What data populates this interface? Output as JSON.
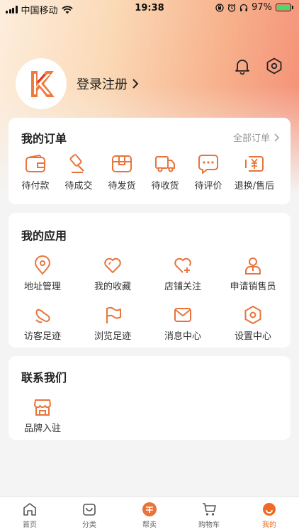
{
  "status_bar": {
    "carrier": "中国移动",
    "time": "19:38",
    "battery": "97%"
  },
  "profile": {
    "avatar_logo": "K",
    "login_label": "登录注册"
  },
  "orders": {
    "title": "我的订单",
    "all_link": "全部订单",
    "items": [
      {
        "label": "待付款",
        "icon": "wallet-icon"
      },
      {
        "label": "待成交",
        "icon": "hammer-icon"
      },
      {
        "label": "待发货",
        "icon": "box-icon"
      },
      {
        "label": "待收货",
        "icon": "truck-icon"
      },
      {
        "label": "待评价",
        "icon": "chat-bubble-icon"
      },
      {
        "label": "退换/售后",
        "icon": "refund-icon"
      }
    ]
  },
  "apps": {
    "title": "我的应用",
    "items": [
      {
        "label": "地址管理",
        "icon": "location-pin-icon"
      },
      {
        "label": "我的收藏",
        "icon": "heart-icon"
      },
      {
        "label": "店铺关注",
        "icon": "heart-plus-icon"
      },
      {
        "label": "申请销售员",
        "icon": "salesperson-icon"
      },
      {
        "label": "访客足迹",
        "icon": "footprint-icon"
      },
      {
        "label": "浏览足迹",
        "icon": "flag-icon"
      },
      {
        "label": "消息中心",
        "icon": "envelope-icon"
      },
      {
        "label": "设置中心",
        "icon": "settings-hexagon-icon"
      }
    ]
  },
  "contact": {
    "title": "联系我们",
    "items": [
      {
        "label": "品牌入驻",
        "icon": "storefront-icon"
      }
    ]
  },
  "tab_bar": {
    "items": [
      {
        "label": "首页",
        "icon": "home-icon",
        "active": false
      },
      {
        "label": "分类",
        "icon": "bag-icon",
        "active": false
      },
      {
        "label": "帮卖",
        "icon": "help-sell-icon",
        "active": false
      },
      {
        "label": "购物车",
        "icon": "cart-icon",
        "active": false
      },
      {
        "label": "我的",
        "icon": "profile-icon",
        "active": true
      }
    ]
  },
  "colors": {
    "accent": "#f26a21",
    "icon_stroke": "#e8743b",
    "background": "#f4f4f4"
  }
}
